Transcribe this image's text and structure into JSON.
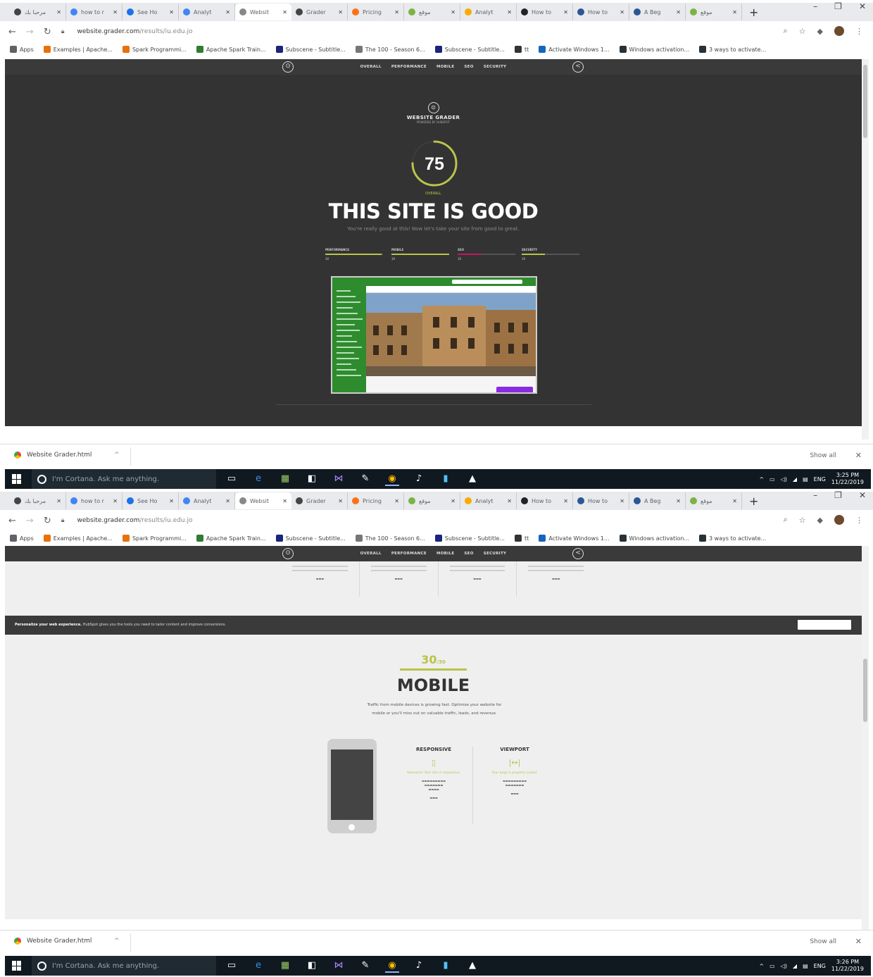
{
  "browser": {
    "tabs": [
      {
        "label": "مرحبا بك",
        "color": "#444444"
      },
      {
        "label": "how to r",
        "color": "#4285f4"
      },
      {
        "label": "See Ho",
        "color": "#1a73e8"
      },
      {
        "label": "Analyt",
        "color": "#4285f4"
      },
      {
        "label": "Websit",
        "color": "#888888",
        "active": true
      },
      {
        "label": "Grader",
        "color": "#444444"
      },
      {
        "label": "Pricing",
        "color": "#f97316"
      },
      {
        "label": "موقع",
        "color": "#7cb342"
      },
      {
        "label": "Analyt",
        "color": "#f9ab00"
      },
      {
        "label": "How to",
        "color": "#222222"
      },
      {
        "label": "How to",
        "color": "#2b5797"
      },
      {
        "label": "A Beg",
        "color": "#2b5797"
      },
      {
        "label": "موقع",
        "color": "#7cb342"
      }
    ],
    "new_tab": "+",
    "window_controls": [
      "–",
      "❐",
      "✕"
    ],
    "url_host": "website.grader.com",
    "url_path": "/results/iu.edu.jo",
    "bookmarks": [
      {
        "label": "Apps",
        "color": "#5f6368"
      },
      {
        "label": "Examples | Apache...",
        "color": "#e8710a"
      },
      {
        "label": "Spark Programmi...",
        "color": "#e8710a"
      },
      {
        "label": "Apache Spark Train...",
        "color": "#2e7d32"
      },
      {
        "label": "Subscene - Subtitle...",
        "color": "#1a237e"
      },
      {
        "label": "The 100 - Season 6...",
        "color": "#777777"
      },
      {
        "label": "Subscene - Subtitle...",
        "color": "#1a237e"
      },
      {
        "label": "tt",
        "color": "#333333"
      },
      {
        "label": "Activate Windows 1...",
        "color": "#1565c0"
      },
      {
        "label": "Windows activation...",
        "color": "#263238"
      },
      {
        "label": "3 ways to activate...",
        "color": "#263238"
      }
    ]
  },
  "site": {
    "nav": [
      "OVERALL",
      "PERFORMANCE",
      "MOBILE",
      "SEO",
      "SECURITY"
    ],
    "brand_title": "WEBSITE GRADER",
    "brand_sub": "POWERED BY HUBSPOT",
    "score": "75",
    "score_fraction": 0.75,
    "score_label": "OVERALL",
    "headline": "THIS SITE IS GOOD",
    "subhead": "You're really good at this! Now let's take your site from good to great.",
    "categories": [
      {
        "label": "PERFORMANCE",
        "value": "30",
        "fill": 0.98,
        "color": "#b9c44a"
      },
      {
        "label": "MOBILE",
        "value": "30",
        "fill": 1.0,
        "color": "#b9c44a"
      },
      {
        "label": "SEO",
        "value": "10",
        "fill": 0.4,
        "color": "#c2185b"
      },
      {
        "label": "SECURITY",
        "value": "10",
        "fill": 0.4,
        "color": "#b9c44a"
      }
    ],
    "accent": "#b9c44a",
    "cookie_text_bold": "Personalize your web experience.",
    "cookie_text": "HubSpot gives you the tools you need to tailor content and improve conversions.",
    "mobile_score": "30",
    "mobile_score_suffix": "/30",
    "mobile_title": "MOBILE",
    "mobile_desc": "Traffic from mobile devices is growing fast. Optimize your website for mobile or you'll miss out on valuable traffic, leads, and revenue.",
    "features": [
      {
        "title": "RESPONSIVE",
        "icon": "▯",
        "icon_name": "tablet-icon",
        "line": "Awesome! Your site is responsive."
      },
      {
        "title": "VIEWPORT",
        "icon": "|↔|",
        "icon_name": "viewport-icon",
        "line": "Your page is properly scaled."
      }
    ]
  },
  "downloads": {
    "file": "Website Grader.html",
    "show_all": "Show all"
  },
  "taskbar": {
    "search_placeholder": "I'm Cortana. Ask me anything.",
    "lang": "ENG",
    "time_1": "3:25 PM",
    "time_2": "3:26 PM",
    "date": "11/22/2019"
  }
}
